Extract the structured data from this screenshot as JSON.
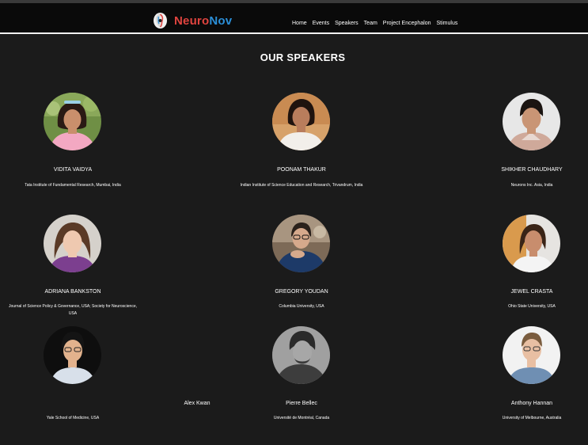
{
  "brand": {
    "name_part1": "Neuro",
    "name_part2": "Nov"
  },
  "nav": {
    "items": [
      "Home",
      "Events",
      "Speakers",
      "Team",
      "Project Encephalon",
      "Stimulus"
    ]
  },
  "section": {
    "title": "OUR SPEAKERS"
  },
  "speakers": [
    {
      "name": "VIDITA VAIDYA",
      "affiliation": "Tata Institute of Fundamental Research, Mumbai, India",
      "photo_icon": "speaker-photo"
    },
    {
      "name": "POONAM THAKUR",
      "affiliation": "Indian Institute of Science Education and Research, Trivandrum, India",
      "photo_icon": "speaker-photo"
    },
    {
      "name": "SHIKHER CHAUDHARY",
      "affiliation": "Neurons Inc. Asia, India",
      "photo_icon": "speaker-photo"
    },
    {
      "name": "ADRIANA BANKSTON",
      "affiliation": "Journal of Science Policy & Governance, USA; Society for Neuroscience, USA",
      "photo_icon": "speaker-photo"
    },
    {
      "name": "GREGORY YOUDAN",
      "affiliation": "Columbia University, USA",
      "photo_icon": "speaker-photo"
    },
    {
      "name": "JEWEL CRASTA",
      "affiliation": "Ohio State University, USA",
      "photo_icon": "speaker-photo"
    },
    {
      "name": "Alex Kwan",
      "affiliation": "Yale School of Medicine, USA",
      "photo_icon": "speaker-photo"
    },
    {
      "name": "Pierre Bellec",
      "affiliation": "Université de Montréal, Canada",
      "photo_icon": "speaker-photo"
    },
    {
      "name": "Anthony Hannan",
      "affiliation": "University of Melbourne, Australia",
      "photo_icon": "speaker-photo"
    }
  ]
}
